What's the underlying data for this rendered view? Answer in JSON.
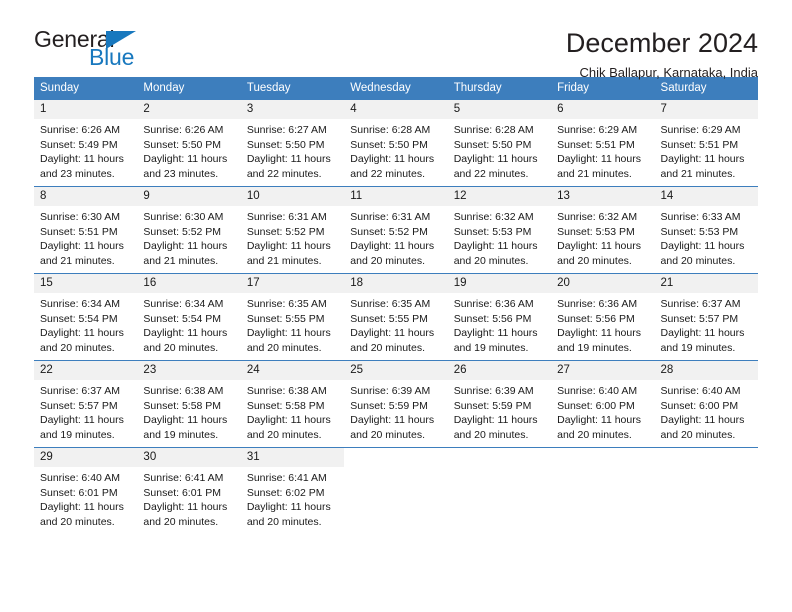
{
  "logo": {
    "word1": "General",
    "word2": "Blue",
    "triangle_color": "#1878be",
    "icon": "triangle-flag-icon"
  },
  "header": {
    "title": "December 2024",
    "subtitle": "Chik Ballapur, Karnataka, India"
  },
  "theme": {
    "header_blue": "#3d7ebd",
    "daynum_band": "#f1f1f1",
    "text": "#1a1a1a"
  },
  "weekday_headers": [
    "Sunday",
    "Monday",
    "Tuesday",
    "Wednesday",
    "Thursday",
    "Friday",
    "Saturday"
  ],
  "labels": {
    "sunrise": "Sunrise:",
    "sunset": "Sunset:",
    "daylight": "Daylight:"
  },
  "weeks": [
    [
      {
        "day": "1",
        "sunrise": "Sunrise: 6:26 AM",
        "sunset": "Sunset: 5:49 PM",
        "daylight1": "Daylight: 11 hours",
        "daylight2": "and 23 minutes."
      },
      {
        "day": "2",
        "sunrise": "Sunrise: 6:26 AM",
        "sunset": "Sunset: 5:50 PM",
        "daylight1": "Daylight: 11 hours",
        "daylight2": "and 23 minutes."
      },
      {
        "day": "3",
        "sunrise": "Sunrise: 6:27 AM",
        "sunset": "Sunset: 5:50 PM",
        "daylight1": "Daylight: 11 hours",
        "daylight2": "and 22 minutes."
      },
      {
        "day": "4",
        "sunrise": "Sunrise: 6:28 AM",
        "sunset": "Sunset: 5:50 PM",
        "daylight1": "Daylight: 11 hours",
        "daylight2": "and 22 minutes."
      },
      {
        "day": "5",
        "sunrise": "Sunrise: 6:28 AM",
        "sunset": "Sunset: 5:50 PM",
        "daylight1": "Daylight: 11 hours",
        "daylight2": "and 22 minutes."
      },
      {
        "day": "6",
        "sunrise": "Sunrise: 6:29 AM",
        "sunset": "Sunset: 5:51 PM",
        "daylight1": "Daylight: 11 hours",
        "daylight2": "and 21 minutes."
      },
      {
        "day": "7",
        "sunrise": "Sunrise: 6:29 AM",
        "sunset": "Sunset: 5:51 PM",
        "daylight1": "Daylight: 11 hours",
        "daylight2": "and 21 minutes."
      }
    ],
    [
      {
        "day": "8",
        "sunrise": "Sunrise: 6:30 AM",
        "sunset": "Sunset: 5:51 PM",
        "daylight1": "Daylight: 11 hours",
        "daylight2": "and 21 minutes."
      },
      {
        "day": "9",
        "sunrise": "Sunrise: 6:30 AM",
        "sunset": "Sunset: 5:52 PM",
        "daylight1": "Daylight: 11 hours",
        "daylight2": "and 21 minutes."
      },
      {
        "day": "10",
        "sunrise": "Sunrise: 6:31 AM",
        "sunset": "Sunset: 5:52 PM",
        "daylight1": "Daylight: 11 hours",
        "daylight2": "and 21 minutes."
      },
      {
        "day": "11",
        "sunrise": "Sunrise: 6:31 AM",
        "sunset": "Sunset: 5:52 PM",
        "daylight1": "Daylight: 11 hours",
        "daylight2": "and 20 minutes."
      },
      {
        "day": "12",
        "sunrise": "Sunrise: 6:32 AM",
        "sunset": "Sunset: 5:53 PM",
        "daylight1": "Daylight: 11 hours",
        "daylight2": "and 20 minutes."
      },
      {
        "day": "13",
        "sunrise": "Sunrise: 6:32 AM",
        "sunset": "Sunset: 5:53 PM",
        "daylight1": "Daylight: 11 hours",
        "daylight2": "and 20 minutes."
      },
      {
        "day": "14",
        "sunrise": "Sunrise: 6:33 AM",
        "sunset": "Sunset: 5:53 PM",
        "daylight1": "Daylight: 11 hours",
        "daylight2": "and 20 minutes."
      }
    ],
    [
      {
        "day": "15",
        "sunrise": "Sunrise: 6:34 AM",
        "sunset": "Sunset: 5:54 PM",
        "daylight1": "Daylight: 11 hours",
        "daylight2": "and 20 minutes."
      },
      {
        "day": "16",
        "sunrise": "Sunrise: 6:34 AM",
        "sunset": "Sunset: 5:54 PM",
        "daylight1": "Daylight: 11 hours",
        "daylight2": "and 20 minutes."
      },
      {
        "day": "17",
        "sunrise": "Sunrise: 6:35 AM",
        "sunset": "Sunset: 5:55 PM",
        "daylight1": "Daylight: 11 hours",
        "daylight2": "and 20 minutes."
      },
      {
        "day": "18",
        "sunrise": "Sunrise: 6:35 AM",
        "sunset": "Sunset: 5:55 PM",
        "daylight1": "Daylight: 11 hours",
        "daylight2": "and 20 minutes."
      },
      {
        "day": "19",
        "sunrise": "Sunrise: 6:36 AM",
        "sunset": "Sunset: 5:56 PM",
        "daylight1": "Daylight: 11 hours",
        "daylight2": "and 19 minutes."
      },
      {
        "day": "20",
        "sunrise": "Sunrise: 6:36 AM",
        "sunset": "Sunset: 5:56 PM",
        "daylight1": "Daylight: 11 hours",
        "daylight2": "and 19 minutes."
      },
      {
        "day": "21",
        "sunrise": "Sunrise: 6:37 AM",
        "sunset": "Sunset: 5:57 PM",
        "daylight1": "Daylight: 11 hours",
        "daylight2": "and 19 minutes."
      }
    ],
    [
      {
        "day": "22",
        "sunrise": "Sunrise: 6:37 AM",
        "sunset": "Sunset: 5:57 PM",
        "daylight1": "Daylight: 11 hours",
        "daylight2": "and 19 minutes."
      },
      {
        "day": "23",
        "sunrise": "Sunrise: 6:38 AM",
        "sunset": "Sunset: 5:58 PM",
        "daylight1": "Daylight: 11 hours",
        "daylight2": "and 19 minutes."
      },
      {
        "day": "24",
        "sunrise": "Sunrise: 6:38 AM",
        "sunset": "Sunset: 5:58 PM",
        "daylight1": "Daylight: 11 hours",
        "daylight2": "and 20 minutes."
      },
      {
        "day": "25",
        "sunrise": "Sunrise: 6:39 AM",
        "sunset": "Sunset: 5:59 PM",
        "daylight1": "Daylight: 11 hours",
        "daylight2": "and 20 minutes."
      },
      {
        "day": "26",
        "sunrise": "Sunrise: 6:39 AM",
        "sunset": "Sunset: 5:59 PM",
        "daylight1": "Daylight: 11 hours",
        "daylight2": "and 20 minutes."
      },
      {
        "day": "27",
        "sunrise": "Sunrise: 6:40 AM",
        "sunset": "Sunset: 6:00 PM",
        "daylight1": "Daylight: 11 hours",
        "daylight2": "and 20 minutes."
      },
      {
        "day": "28",
        "sunrise": "Sunrise: 6:40 AM",
        "sunset": "Sunset: 6:00 PM",
        "daylight1": "Daylight: 11 hours",
        "daylight2": "and 20 minutes."
      }
    ],
    [
      {
        "day": "29",
        "sunrise": "Sunrise: 6:40 AM",
        "sunset": "Sunset: 6:01 PM",
        "daylight1": "Daylight: 11 hours",
        "daylight2": "and 20 minutes."
      },
      {
        "day": "30",
        "sunrise": "Sunrise: 6:41 AM",
        "sunset": "Sunset: 6:01 PM",
        "daylight1": "Daylight: 11 hours",
        "daylight2": "and 20 minutes."
      },
      {
        "day": "31",
        "sunrise": "Sunrise: 6:41 AM",
        "sunset": "Sunset: 6:02 PM",
        "daylight1": "Daylight: 11 hours",
        "daylight2": "and 20 minutes."
      },
      {
        "day": "",
        "sunrise": "",
        "sunset": "",
        "daylight1": "",
        "daylight2": ""
      },
      {
        "day": "",
        "sunrise": "",
        "sunset": "",
        "daylight1": "",
        "daylight2": ""
      },
      {
        "day": "",
        "sunrise": "",
        "sunset": "",
        "daylight1": "",
        "daylight2": ""
      },
      {
        "day": "",
        "sunrise": "",
        "sunset": "",
        "daylight1": "",
        "daylight2": ""
      }
    ]
  ]
}
